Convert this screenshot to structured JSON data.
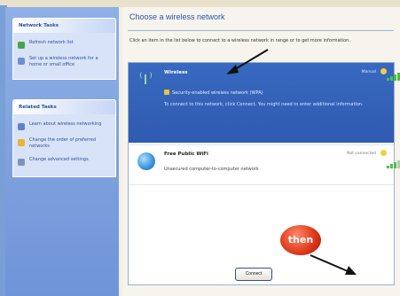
{
  "content": {
    "title": "Choose a wireless network",
    "instructions": "Click an item in the list below to connect to a wireless network in range or to get more information."
  },
  "sidebar": {
    "network_tasks": {
      "header": "Network Tasks",
      "items": [
        {
          "label": "Refresh network list",
          "icon": "refresh-icon"
        },
        {
          "label": "Set up a wireless network for a home or small office",
          "icon": "setup-icon"
        }
      ]
    },
    "related_tasks": {
      "header": "Related Tasks",
      "items": [
        {
          "label": "Learn about wireless networking",
          "icon": "info-icon"
        },
        {
          "label": "Change the order of preferred networks",
          "icon": "star-icon"
        },
        {
          "label": "Change advanced settings",
          "icon": "gear-icon"
        }
      ]
    }
  },
  "networks": [
    {
      "name": "Wireless",
      "status": "Manual",
      "security": "Security-enabled wireless network (WPA)",
      "description": "To connect to this network, click Connect. You might need to enter additional information.",
      "signal": 1.0,
      "selected": true
    },
    {
      "name": "Free Public WiFi",
      "status": "Not connected",
      "security": "Unsecured computer-to-computer network",
      "signal": 0.6,
      "selected": false
    }
  ],
  "connect_button": "Connect",
  "annotation": "then",
  "colors": {
    "selection": "#2f5bb0",
    "sidebar": "#7a9fd6",
    "annotation": "#e03a1c"
  }
}
